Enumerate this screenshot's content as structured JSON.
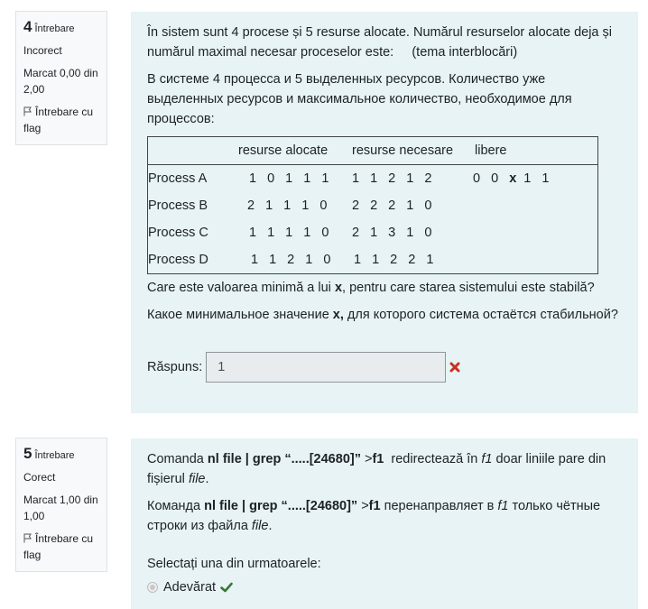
{
  "q4": {
    "number": "4",
    "label": "Întrebare",
    "state": "Incorect",
    "grade": "Marcat 0,00 din 2,00",
    "flag": "Întrebare cu flag",
    "text_ro": "În sistem sunt 4 procese și 5 resurse alocate. Numărul resurselor alocate deja și numărul maximal necesar proceselor este:     (tema interblocări)",
    "text_ru": "В системе 4 процесса и 5 выделенных ресурсов. Количество уже выделенных ресурсов и максимальное количество, необходимое для процессов:",
    "table": {
      "headers": [
        "",
        "resurse alocate",
        "resurse necesare",
        "libere"
      ],
      "rows": [
        {
          "name": "Process A",
          "alloc": "1 0 1 1 1",
          "need": "1 1 2 1 2",
          "free_pre": "0 0 ",
          "free_x": "x",
          "free_post": " 1 1"
        },
        {
          "name": "Process B",
          "alloc": "2 1 1 1 0",
          "need": "2 2 2 1 0",
          "free_pre": "",
          "free_x": "",
          "free_post": ""
        },
        {
          "name": "Process C",
          "alloc": "1 1 1 1 0",
          "need": "2 1 3 1 0",
          "free_pre": "",
          "free_x": "",
          "free_post": ""
        },
        {
          "name": "Process D",
          "alloc": "1 1 2 1 0",
          "need": "1 1 2 2 1",
          "free_pre": "",
          "free_x": "",
          "free_post": ""
        }
      ]
    },
    "question_ro_pre": "Care este valoarea minimă a lui ",
    "question_ro_x": "x",
    "question_ro_post": ", pentru care starea sistemului este stabilă?",
    "question_ru_pre": "Какое минимальное значение ",
    "question_ru_x": "x,",
    "question_ru_post": " для которого система остаётся стабильной?",
    "answer_label": "Răspuns:",
    "answer_value": "1",
    "result_icon": "x-incorrect-icon",
    "result_color": "#ca3120"
  },
  "q5": {
    "number": "5",
    "label": "Întrebare",
    "state": "Corect",
    "grade": "Marcat 1,00 din 1,00",
    "flag": "Întrebare cu flag",
    "ro_pre": "Comanda ",
    "ro_cmd": "nl file | grep “.....[24680]” ",
    "ro_gt": ">",
    "ro_f1": "f1",
    "ro_mid": "  redirectează în ",
    "ro_f1i": "f1",
    "ro_mid2": " doar liniile pare din fișierul ",
    "ro_file": "file",
    "ro_end": ".",
    "ru_pre": "Команда ",
    "ru_cmd": "nl file | grep “.....[24680]” ",
    "ru_gt": ">",
    "ru_f1": "f1",
    "ru_mid": " перенаправляет в ",
    "ru_f1i": "f1",
    "ru_mid2": " только чётные строки из файла ",
    "ru_file": "file",
    "ru_end": ".",
    "select_prompt": "Selectați una din urmatoarele:",
    "option": "Adevărat",
    "result_icon": "check-correct-icon",
    "result_color": "#357a32"
  }
}
